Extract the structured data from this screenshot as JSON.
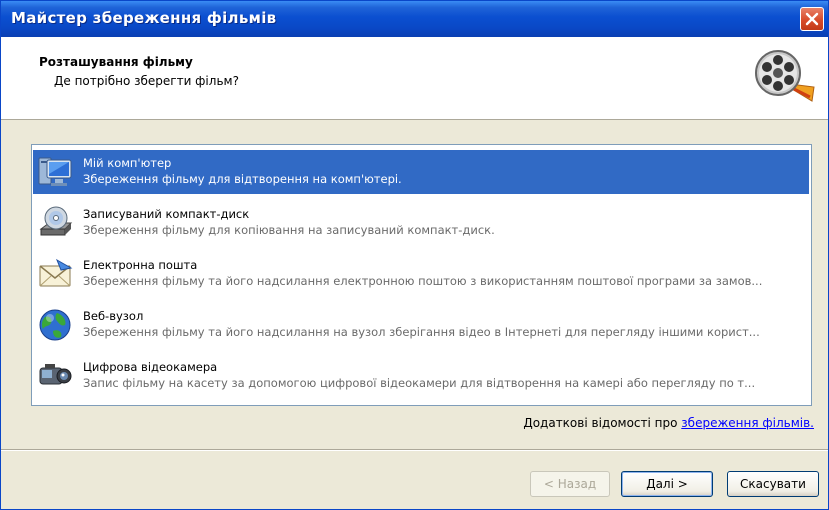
{
  "window": {
    "title": "Майстер збереження фільмів"
  },
  "header": {
    "title": "Розташування фільму",
    "subtitle": "Де потрібно зберегти фільм?"
  },
  "options": [
    {
      "name": "Мій комп'ютер",
      "description": "Збереження фільму для відтворення на комп'ютері.",
      "icon": "computer-icon",
      "selected": true
    },
    {
      "name": "Записуваний компакт-диск",
      "description": "Збереження фільму для копіювання на записуваний компакт-диск.",
      "icon": "cd-drive-icon",
      "selected": false
    },
    {
      "name": "Електронна пошта",
      "description": "Збереження фільму та його надсилання електронною поштою з використанням поштової програми за замов...",
      "icon": "email-envelope-icon",
      "selected": false
    },
    {
      "name": "Веб-вузол",
      "description": "Збереження фільму та його надсилання на вузол зберігання відео в Інтернеті для перегляду іншими корист...",
      "icon": "globe-icon",
      "selected": false
    },
    {
      "name": "Цифрова відеокамера",
      "description": "Запис фільму на касету за допомогою цифрової відеокамери для відтворення на камері або перегляду по т...",
      "icon": "camcorder-icon",
      "selected": false
    }
  ],
  "more_info": {
    "prefix": "Додаткові відомості про ",
    "link": "збереження фільмів."
  },
  "buttons": {
    "back": "< Назад",
    "next": "Далі >",
    "cancel": "Скасувати"
  },
  "colors": {
    "titlebar": "#0a48c6",
    "selection": "#316ac5",
    "background": "#ece9d8",
    "link": "#0000ff"
  }
}
